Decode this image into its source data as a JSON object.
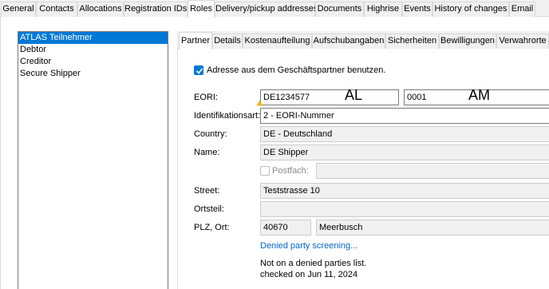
{
  "window_tabs": [
    {
      "label": "General",
      "active": false
    },
    {
      "label": "Contacts",
      "active": false
    },
    {
      "label": "Allocations",
      "active": false
    },
    {
      "label": "Registration IDs",
      "active": false
    },
    {
      "label": "Roles",
      "active": true
    },
    {
      "label": "Delivery/pickup addresses",
      "active": false
    },
    {
      "label": "Documents",
      "active": false
    },
    {
      "label": "Highrise",
      "active": false
    },
    {
      "label": "Events",
      "active": false
    },
    {
      "label": "History of changes",
      "active": false
    },
    {
      "label": "Email",
      "active": false
    }
  ],
  "roles": [
    {
      "label": "ATLAS Teilnehmer",
      "selected": true
    },
    {
      "label": "Debtor",
      "selected": false
    },
    {
      "label": "Creditor",
      "selected": false
    },
    {
      "label": "Secure Shipper",
      "selected": false
    }
  ],
  "inner_tabs": [
    {
      "label": "Partner",
      "active": true
    },
    {
      "label": "Details",
      "active": false
    },
    {
      "label": "Kostenaufteilung",
      "active": false
    },
    {
      "label": "Aufschubangaben",
      "active": false
    },
    {
      "label": "Sicherheiten",
      "active": false
    },
    {
      "label": "Bewilligungen",
      "active": false
    },
    {
      "label": "Verwahrorte",
      "active": false
    }
  ],
  "form": {
    "use_address_checkbox": {
      "label": "Adresse aus dem Geschäftspartner benutzen.",
      "checked": true
    },
    "eori": {
      "label": "EORI:",
      "value": "DE1234577",
      "suffix_value": "0001",
      "annotation_1": "AL",
      "annotation_2": "AM",
      "warning_icon": "warning-icon"
    },
    "identifikationsart": {
      "label": "Identifikationsart:",
      "value": "2 - EORI-Nummer"
    },
    "country": {
      "label": "Country:",
      "value": "DE - Deutschland"
    },
    "name": {
      "label": "Name:",
      "value": "DE Shipper"
    },
    "postfach": {
      "label": "Postfach:",
      "checked": false,
      "value": ""
    },
    "street": {
      "label": "Street:",
      "value": "Teststrasse 10"
    },
    "ortsteil": {
      "label": "Ortsteil:",
      "value": ""
    },
    "plz_ort": {
      "label": "PLZ, Ort:",
      "plz": "40670",
      "ort": "Meerbusch"
    },
    "denied_party_link": "Denied party screening...",
    "screening_status": "Not on a denied parties list.",
    "screening_checked": "checked on Jun 11, 2024"
  },
  "colors": {
    "accent": "#0078d7",
    "link": "#0066cc",
    "warning": "#f2b01e"
  }
}
